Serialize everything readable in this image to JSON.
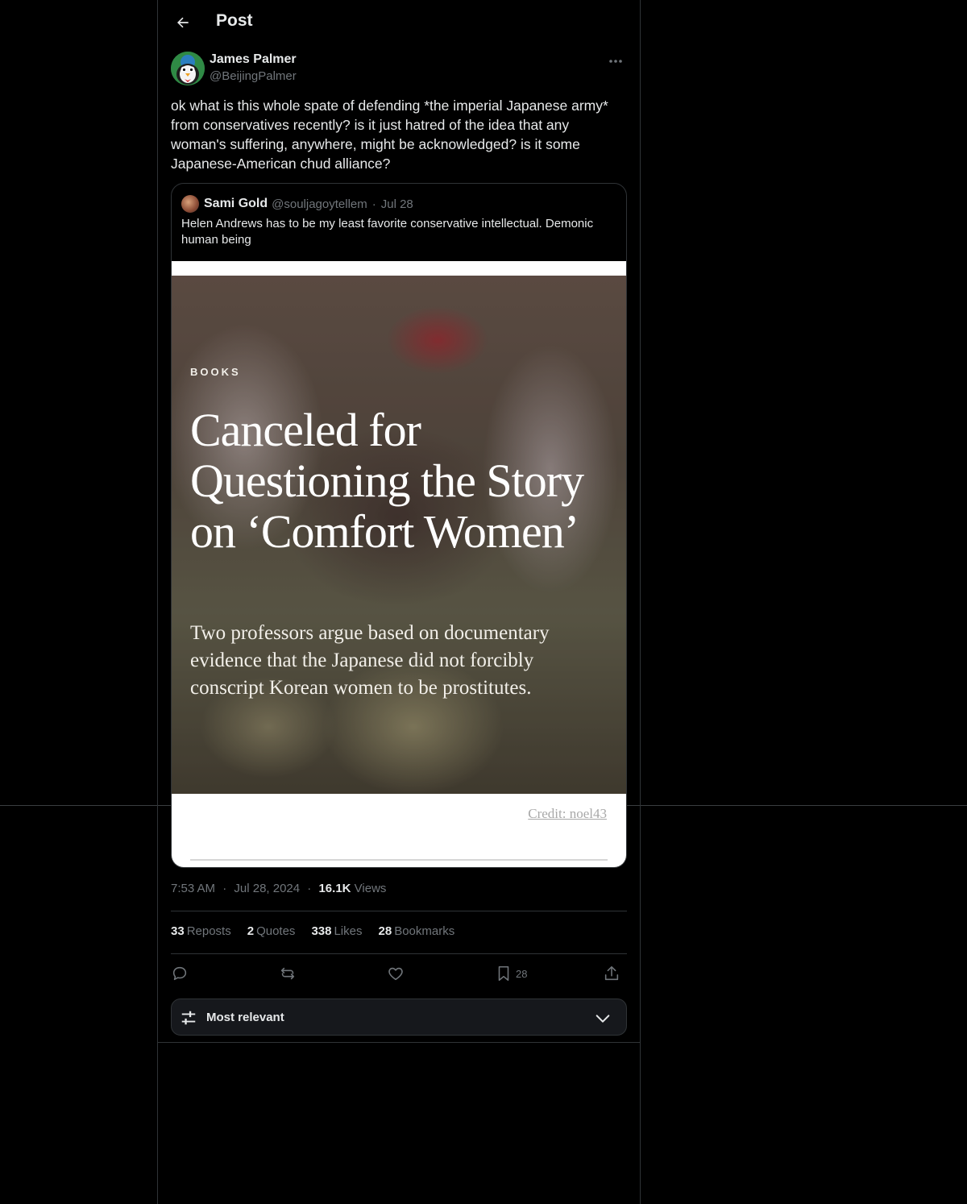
{
  "header": {
    "title": "Post"
  },
  "author": {
    "name": "James Palmer",
    "handle": "@BeijingPalmer"
  },
  "post": {
    "text": "ok what is this whole spate of defending *the imperial Japanese army* from conservatives recently? is it just hatred of the idea that any woman's suffering, anywhere, might be acknowledged? is it some Japanese-American chud alliance?"
  },
  "quote": {
    "name": "Sami Gold",
    "handle": "@souljagoytellem",
    "separator": "·",
    "date": "Jul 28",
    "text": "Helen Andrews has to be my least favorite conservative intellectual. Demonic human being",
    "media": {
      "kicker": "BOOKS",
      "title": "Canceled for Questioning the Story on ‘Comfort Women’",
      "subtitle": "Two professors argue based on documentary evidence that the Japanese did not forcibly conscript Korean women to be prostitutes.",
      "credit": "Credit: noel43"
    }
  },
  "meta": {
    "time": "7:53 AM",
    "sep1": "·",
    "date": "Jul 28, 2024",
    "sep2": "·",
    "views_count": "16.1K",
    "views_label": "Views"
  },
  "stats": [
    {
      "count": "33",
      "label": "Reposts"
    },
    {
      "count": "2",
      "label": "Quotes"
    },
    {
      "count": "338",
      "label": "Likes"
    },
    {
      "count": "28",
      "label": "Bookmarks"
    }
  ],
  "actions": {
    "bookmark_count": "28"
  },
  "sort": {
    "label": "Most relevant"
  },
  "icons": {
    "back": "arrow-left-icon",
    "more": "more-horizontal-icon",
    "reply": "reply-icon",
    "repost": "repost-icon",
    "like": "heart-icon",
    "bookmark": "bookmark-icon",
    "share": "share-icon",
    "sort": "sliders-icon",
    "chevron": "chevron-down-icon"
  },
  "colors": {
    "background": "#000000",
    "text": "#e7e9ea",
    "secondary": "#71767b",
    "border": "#2f3336"
  }
}
